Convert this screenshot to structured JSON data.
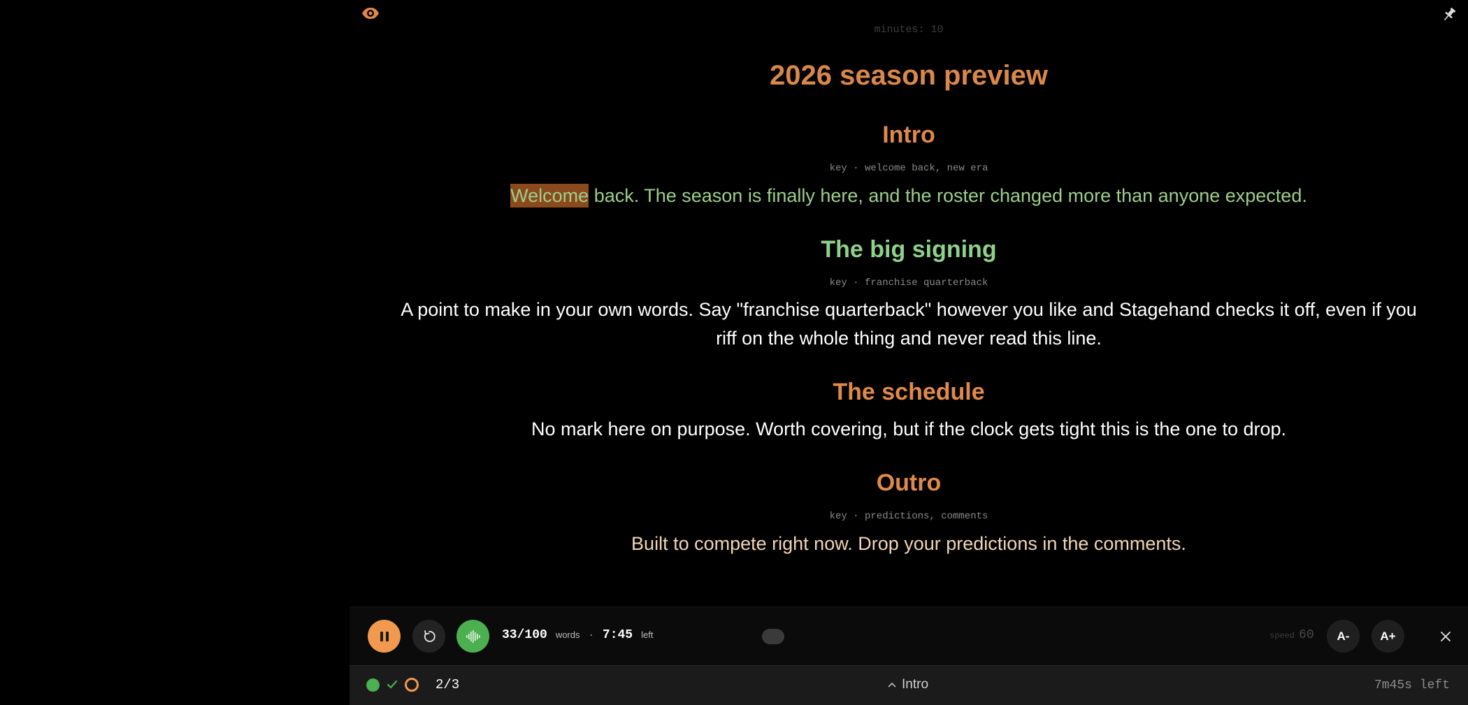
{
  "colors": {
    "accent_orange": "#d9884a",
    "button_orange": "#f1994e",
    "spoken_green": "#9ccf8a",
    "heading_green": "#8fd18a",
    "upcoming_cream": "#f2d6b3",
    "highlight_word_bg": "#8b4a1e",
    "status_green": "#4caf50"
  },
  "script": {
    "meta_top": "minutes: 10",
    "title": "2026 season preview",
    "sections": [
      {
        "heading": "Intro",
        "key": "key · welcome back, new era",
        "highlight_word": "Welcome",
        "text_rest": " back. The season is finally here, and the roster changed more than anyone expected."
      },
      {
        "heading": "The big signing",
        "key": "key · franchise quarterback",
        "text": "A point to make in your own words. Say \"franchise quarterback\" however you like and Stagehand checks it off, even if you riff on the whole thing and never read this line."
      },
      {
        "heading": "The schedule",
        "text": "No mark here on purpose. Worth covering, but if the clock gets tight this is the one to drop."
      },
      {
        "heading": "Outro",
        "key": "key · predictions, comments",
        "text": "Built to compete right now. Drop your predictions in the comments."
      }
    ]
  },
  "controls": {
    "words_count": "33/100",
    "words_label": "words",
    "separator": "·",
    "time": "7:45",
    "time_label": "left",
    "speed_label": "speed",
    "speed_value": "60",
    "font_decrease": "A-",
    "font_increase": "A+"
  },
  "footer": {
    "progress": "2/3",
    "current_section": "Intro",
    "time_left": "7m45s left"
  }
}
